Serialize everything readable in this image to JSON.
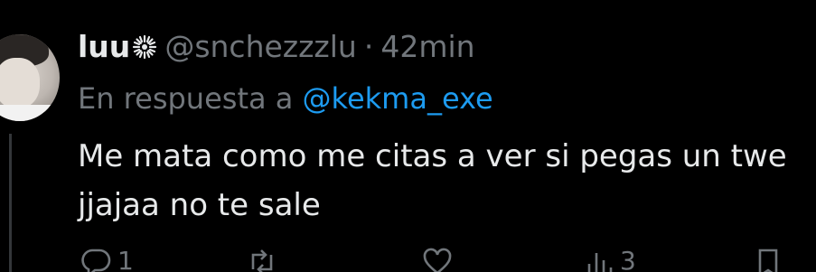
{
  "tweet": {
    "author_name": "luu",
    "author_handle": "@snchezzzlu",
    "separator": "·",
    "time": "42min",
    "reply_prefix": "En respuesta a",
    "reply_mention": "@kekma_exe",
    "text_line1": "Me mata como me citas a ver si pegas un twe",
    "text_line2": "jjajaa no te sale"
  },
  "actions": {
    "reply_count": "1",
    "retweet_count": "",
    "like_count": "",
    "views_count": "3"
  },
  "icons": {
    "name_badge": "sunburst-icon",
    "reply": "comment-icon",
    "retweet": "retweet-icon",
    "like": "heart-icon",
    "views": "bar-chart-icon",
    "bookmark": "bookmark-icon"
  },
  "colors": {
    "background": "#000000",
    "primary_text": "#e7e9ea",
    "secondary_text": "#71767b",
    "link": "#1d9bf0"
  }
}
